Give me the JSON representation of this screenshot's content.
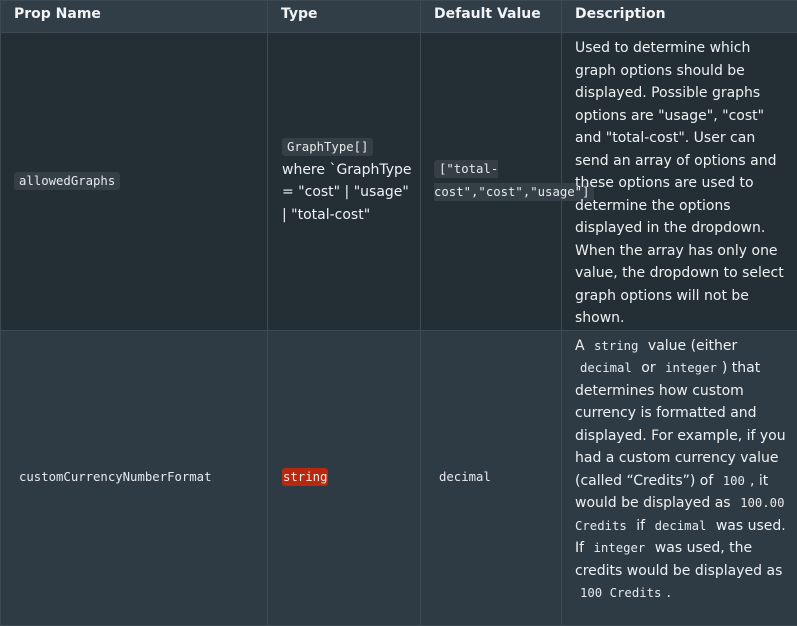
{
  "headers": {
    "prop_name": "Prop Name",
    "type": "Type",
    "default_value": "Default Value",
    "description": "Description"
  },
  "rows": [
    {
      "prop": "allowedGraphs",
      "type_code": "GraphType[]",
      "type_text": "where `GraphType = \"cost\" | \"usage\" | \"total-cost\"",
      "default": "[\"total-cost\",\"cost\",\"usage\"]",
      "description": "Used to determine which graph options should be displayed. Possible graphs options are \"usage\", \"cost\" and \"total-cost\". User can send an array of options and these options are used to determine the options displayed in the dropdown. When the array has only one value, the dropdown to select graph options will not be shown."
    },
    {
      "prop": "customCurrencyNumberFormat",
      "type_code": "string",
      "default": "decimal",
      "description": {
        "t1": "A",
        "c1": "string",
        "t2": "value (either",
        "c2": "decimal",
        "t3": "or",
        "c3": "integer",
        "t4": ") that determines how custom currency is formatted and displayed. For example, if you had a custom currency value (called “Credits”) of",
        "c4": "100",
        "t5": ", it would be displayed as",
        "c5": "100.00 Credits",
        "t6": "if",
        "c6": "decimal",
        "t7": "was used. If",
        "c7": "integer",
        "t8": "was used, the credits would be displayed as",
        "c8": "100 Credits",
        "t9": "."
      }
    }
  ]
}
